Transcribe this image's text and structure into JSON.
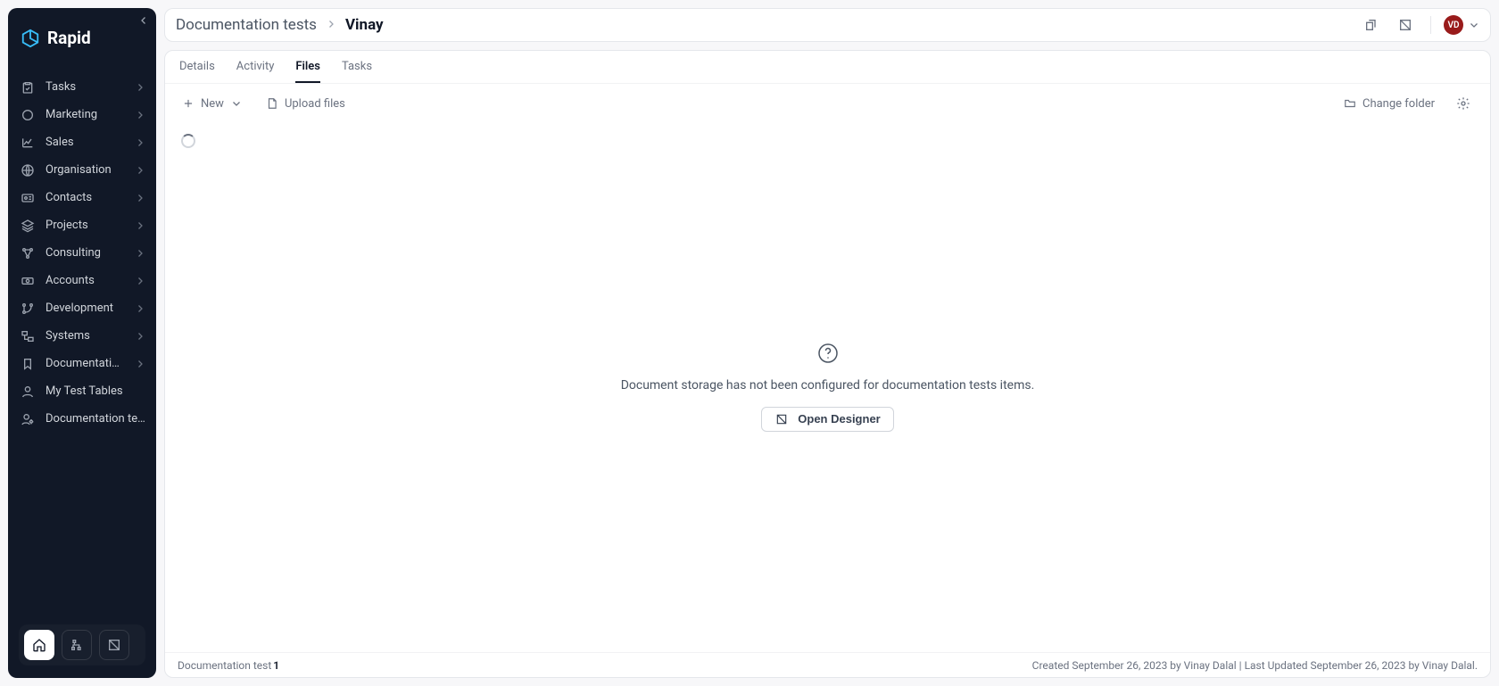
{
  "brand": {
    "name": "Rapid"
  },
  "sidebar": {
    "items": [
      {
        "label": "Tasks",
        "icon": "clipboard-check-icon",
        "expandable": true
      },
      {
        "label": "Marketing",
        "icon": "circle-icon",
        "expandable": true
      },
      {
        "label": "Sales",
        "icon": "chart-line-icon",
        "expandable": true
      },
      {
        "label": "Organisation",
        "icon": "globe-icon",
        "expandable": true
      },
      {
        "label": "Contacts",
        "icon": "id-card-icon",
        "expandable": true
      },
      {
        "label": "Projects",
        "icon": "layers-icon",
        "expandable": true
      },
      {
        "label": "Consulting",
        "icon": "network-icon",
        "expandable": true
      },
      {
        "label": "Accounts",
        "icon": "cash-icon",
        "expandable": true
      },
      {
        "label": "Development",
        "icon": "branch-icon",
        "expandable": true
      },
      {
        "label": "Systems",
        "icon": "diagram-icon",
        "expandable": true
      },
      {
        "label": "Documentation",
        "icon": "bookmark-icon",
        "expandable": true
      },
      {
        "label": "My Test Tables",
        "icon": "user-icon",
        "expandable": false
      },
      {
        "label": "Documentation tests",
        "icon": "user-cog-icon",
        "expandable": false
      }
    ],
    "footer_buttons": [
      "home-icon",
      "sitemap-icon",
      "tool-icon"
    ]
  },
  "header": {
    "breadcrumb_parent": "Documentation tests",
    "breadcrumb_current": "Vinay",
    "user_initials": "VD"
  },
  "tabs": [
    {
      "label": "Details",
      "active": false
    },
    {
      "label": "Activity",
      "active": false
    },
    {
      "label": "Files",
      "active": true
    },
    {
      "label": "Tasks",
      "active": false
    }
  ],
  "toolbar": {
    "new_label": "New",
    "upload_label": "Upload files",
    "change_folder_label": "Change folder"
  },
  "empty": {
    "message": "Document storage has not been configured for documentation tests items.",
    "button_label": "Open Designer"
  },
  "footer": {
    "left_label": "Documentation test",
    "left_value": "1",
    "right_text": "Created September 26, 2023 by Vinay Dalal | Last Updated September 26, 2023 by Vinay Dalal."
  }
}
